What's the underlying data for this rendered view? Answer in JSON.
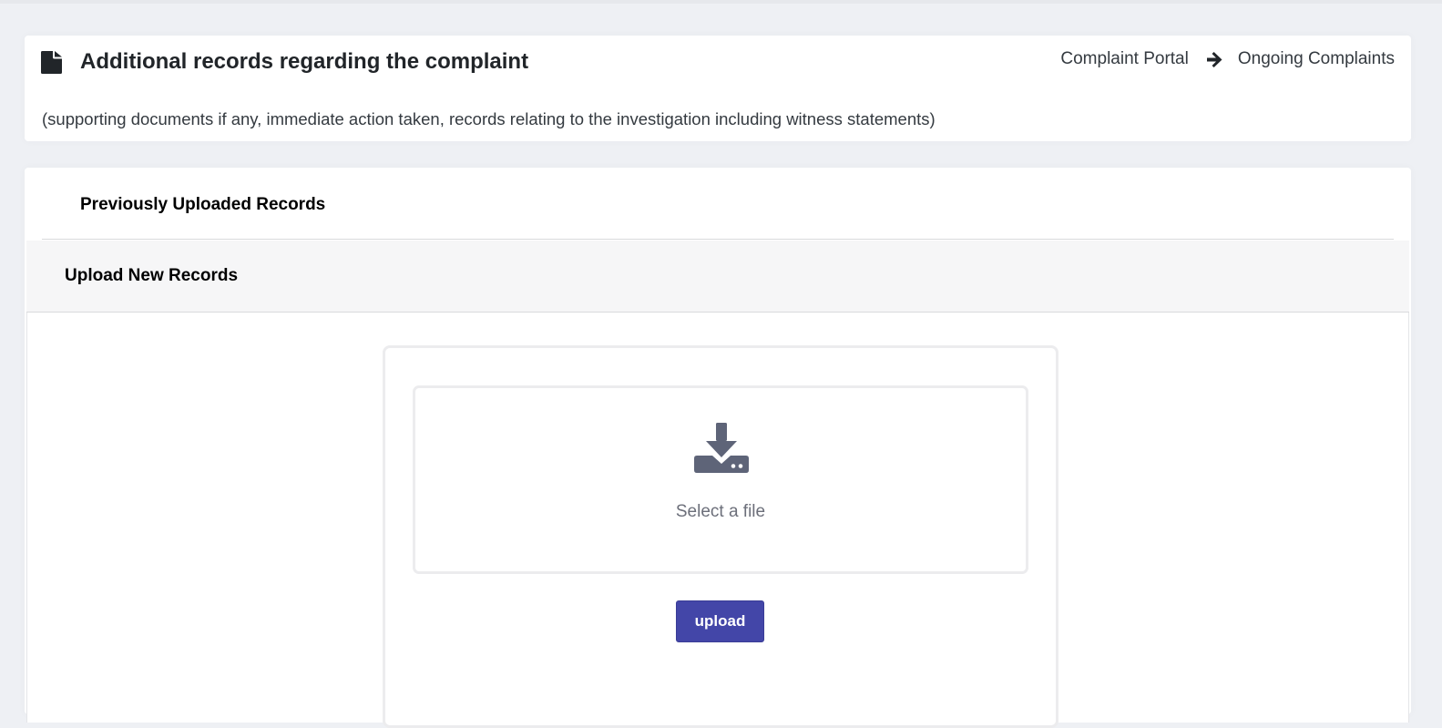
{
  "header": {
    "title": "Additional records regarding the complaint",
    "subtitle": "(supporting documents if any, immediate action taken, records relating to the investigation including witness statements)",
    "icon": "file-icon",
    "breadcrumb": [
      "Complaint Portal",
      "Ongoing Complaints"
    ],
    "breadcrumb_separator_icon": "arrow-right-icon"
  },
  "sections": {
    "previous_title": "Previously Uploaded Records",
    "upload_title": "Upload New Records"
  },
  "uploader": {
    "icon": "download-icon",
    "select_label": "Select a file",
    "upload_label": "upload"
  },
  "colors": {
    "accent": "#4346a8",
    "icon_gray": "#5e6478",
    "background": "#eef0f4"
  }
}
